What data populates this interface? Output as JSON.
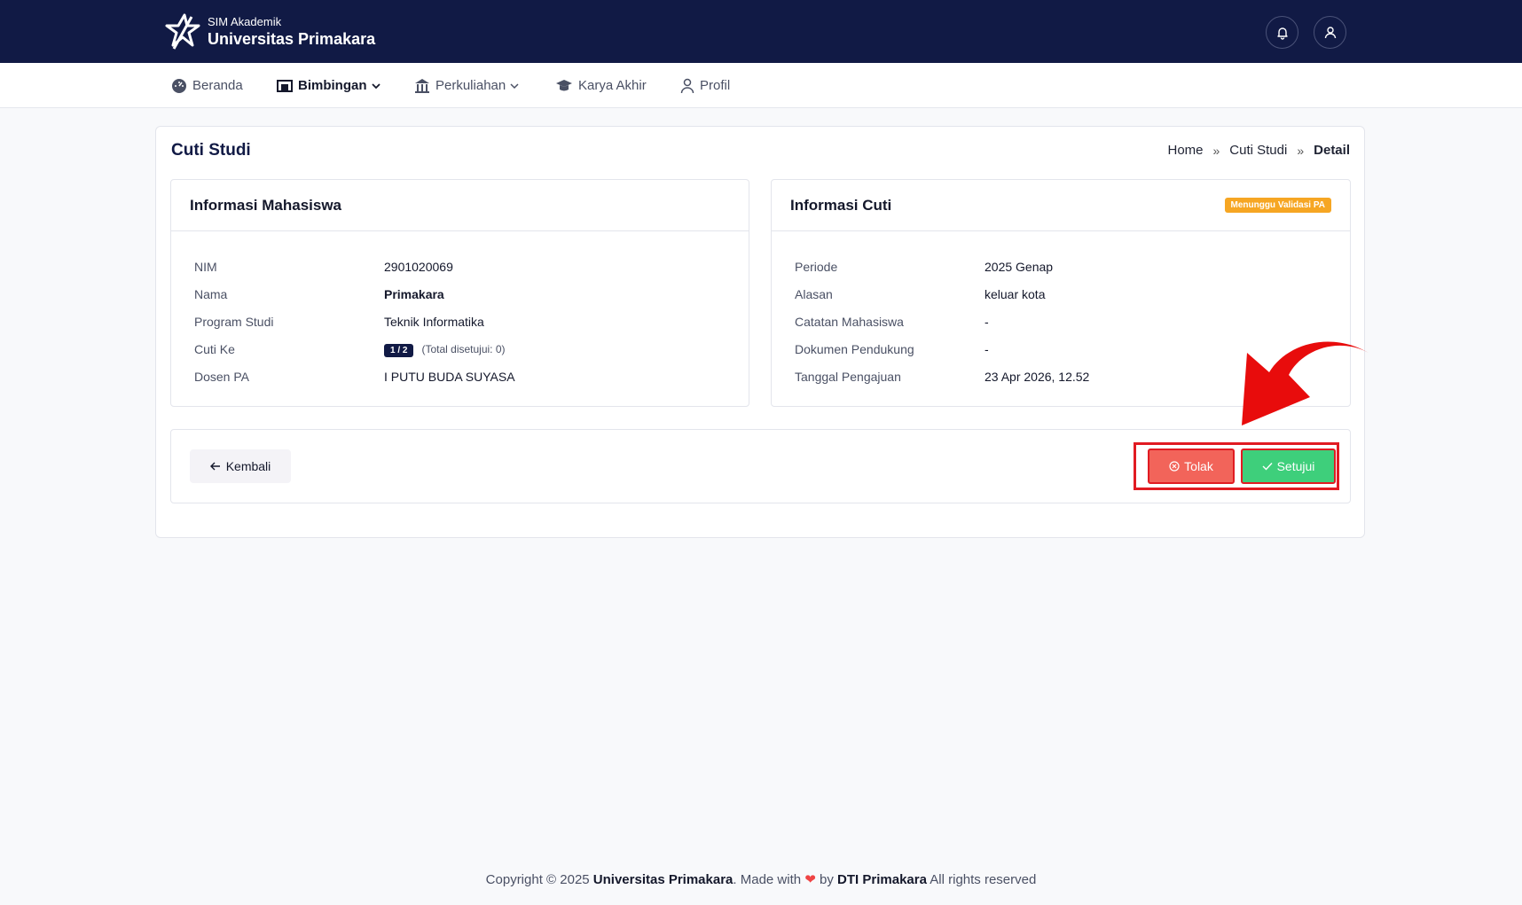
{
  "header": {
    "app_sub": "SIM Akademik",
    "app_name": "Universitas Primakara",
    "icons": [
      "bell-icon",
      "user-icon"
    ],
    "bg_color": "#111a45"
  },
  "nav": {
    "items": [
      {
        "label": "Beranda",
        "icon": "dashboard-icon"
      },
      {
        "label": "Bimbingan",
        "icon": "board-icon",
        "active": true
      },
      {
        "label": "Perkuliahan",
        "icon": "building-icon"
      },
      {
        "label": "Karya Akhir",
        "icon": "graduation-cap-icon"
      },
      {
        "label": "Profil",
        "icon": "user-icon"
      }
    ]
  },
  "page": {
    "title": "Cuti Studi",
    "breadcrumb": [
      "Home",
      "Cuti Studi",
      "Detail"
    ],
    "breadcrumb_sep": "»"
  },
  "mahasiswa": {
    "title": "Informasi Mahasiswa",
    "nim_label": "NIM",
    "nim": "2901020069",
    "nama_label": "Nama",
    "nama": "Primakara",
    "prodi_label": "Program Studi",
    "prodi": "Teknik Informatika",
    "cuti_label": "Cuti Ke",
    "cuti_pill": "1 / 2",
    "cuti_note": "(Total disetujui: 0)",
    "dosen_label": "Dosen PA",
    "dosen": "I PUTU BUDA SUYASA"
  },
  "cuti": {
    "title": "Informasi Cuti",
    "status": "Menunggu Validasi PA",
    "status_color": "#f6a623",
    "periode_label": "Periode",
    "periode": "2025 Genap",
    "alasan_label": "Alasan",
    "alasan": "keluar kota",
    "catatan_label": "Catatan Mahasiswa",
    "catatan": "-",
    "dokumen_label": "Dokumen Pendukung",
    "dokumen": "-",
    "tanggal_label": "Tanggal Pengajuan",
    "tanggal": "23 Apr 2026, 12.52"
  },
  "actions": {
    "back": "Kembali",
    "tolak": "Tolak",
    "setujui": "Setujui",
    "tolak_color": "#f2645a",
    "setujui_color": "#3ecf7b",
    "highlight_color": "#e11b22"
  },
  "footer": {
    "copy_prefix": "Copyright © 2025",
    "org": "Universitas Primakara",
    "made": ". Made with",
    "heart": "❤",
    "by": "by",
    "dti": "DTI Primakara",
    "rights": "All rights reserved"
  }
}
